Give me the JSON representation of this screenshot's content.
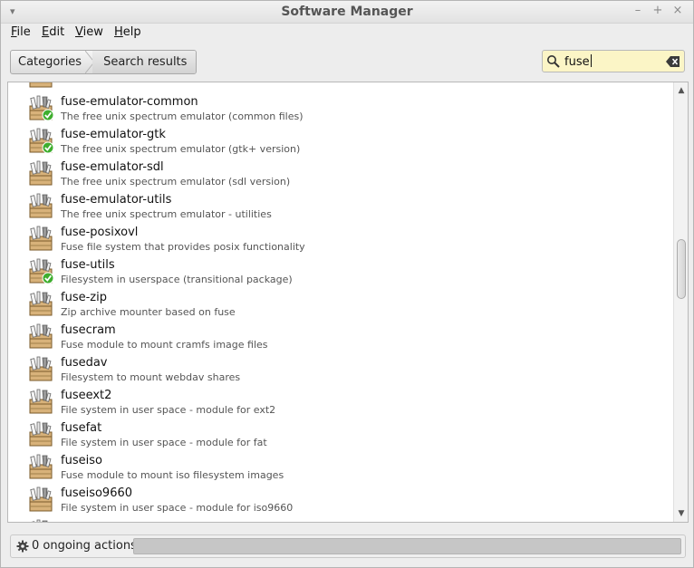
{
  "window": {
    "title": "Software Manager"
  },
  "menu": {
    "file": "File",
    "edit": "Edit",
    "view": "View",
    "help": "Help"
  },
  "breadcrumb": {
    "categories": "Categories",
    "search_results": "Search results"
  },
  "search": {
    "value": "fuse"
  },
  "packages": [
    {
      "name": "fuse-emulator-common",
      "desc": "The free unix spectrum emulator (common files)",
      "installed": true
    },
    {
      "name": "fuse-emulator-gtk",
      "desc": "The free unix spectrum emulator (gtk+ version)",
      "installed": true
    },
    {
      "name": "fuse-emulator-sdl",
      "desc": "The free unix spectrum emulator (sdl version)",
      "installed": false
    },
    {
      "name": "fuse-emulator-utils",
      "desc": "The free unix spectrum emulator - utilities",
      "installed": false
    },
    {
      "name": "fuse-posixovl",
      "desc": "Fuse file system that provides posix functionality",
      "installed": false
    },
    {
      "name": "fuse-utils",
      "desc": "Filesystem in userspace (transitional package)",
      "installed": true
    },
    {
      "name": "fuse-zip",
      "desc": "Zip archive mounter based on fuse",
      "installed": false
    },
    {
      "name": "fusecram",
      "desc": "Fuse module to mount cramfs image files",
      "installed": false
    },
    {
      "name": "fusedav",
      "desc": "Filesystem to mount webdav shares",
      "installed": false
    },
    {
      "name": "fuseext2",
      "desc": "File system in user space - module for ext2",
      "installed": false
    },
    {
      "name": "fusefat",
      "desc": "File system in user space - module for fat",
      "installed": false
    },
    {
      "name": "fuseiso",
      "desc": "Fuse module to mount iso filesystem images",
      "installed": false
    },
    {
      "name": "fuseiso9660",
      "desc": "File system in user space - module for iso9660",
      "installed": false
    }
  ],
  "status": {
    "text": "0 ongoing actions"
  },
  "colors": {
    "search_bg": "#fbf5c6",
    "check_green": "#3fae2f",
    "box_tan": "#d8b27a"
  }
}
